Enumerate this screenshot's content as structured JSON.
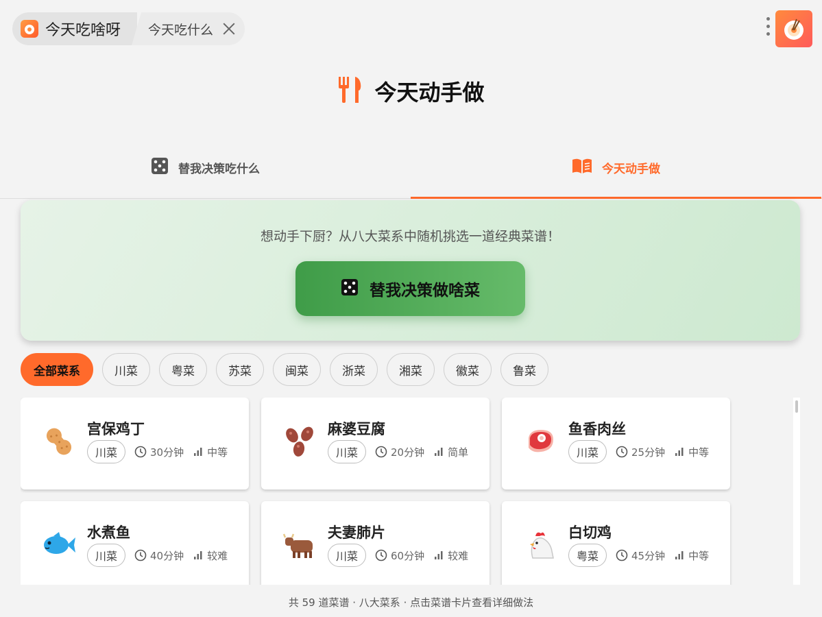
{
  "window": {
    "app_title": "今天吃啥呀",
    "tab_title": "今天吃什么"
  },
  "header": {
    "title": "今天动手做"
  },
  "nav": {
    "tabs": [
      {
        "label": "替我决策吃什么",
        "icon": "dice-icon"
      },
      {
        "label": "今天动手做",
        "icon": "book-icon"
      }
    ]
  },
  "hero": {
    "subtitle": "想动手下厨？从八大菜系中随机挑选一道经典菜谱！",
    "cta_label": "替我决策做啥菜"
  },
  "filters": [
    "全部菜系",
    "川菜",
    "粤菜",
    "苏菜",
    "闽菜",
    "浙菜",
    "湘菜",
    "徽菜",
    "鲁菜"
  ],
  "recipes": [
    {
      "name": "宫保鸡丁",
      "cuisine": "川菜",
      "time": "30分钟",
      "difficulty": "中等",
      "icon": "peanut-icon"
    },
    {
      "name": "麻婆豆腐",
      "cuisine": "川菜",
      "time": "20分钟",
      "difficulty": "简单",
      "icon": "beans-icon"
    },
    {
      "name": "鱼香肉丝",
      "cuisine": "川菜",
      "time": "25分钟",
      "difficulty": "中等",
      "icon": "meat-icon"
    },
    {
      "name": "水煮鱼",
      "cuisine": "川菜",
      "time": "40分钟",
      "difficulty": "较难",
      "icon": "fish-icon"
    },
    {
      "name": "夫妻肺片",
      "cuisine": "川菜",
      "time": "60分钟",
      "difficulty": "较难",
      "icon": "ox-icon"
    },
    {
      "name": "白切鸡",
      "cuisine": "粤菜",
      "time": "45分钟",
      "difficulty": "中等",
      "icon": "chicken-icon"
    }
  ],
  "footer": {
    "text": "共 59 道菜谱 · 八大菜系 · 点击菜谱卡片查看详细做法"
  },
  "colors": {
    "accent": "#ff6a2b",
    "cta": "#4caf50"
  }
}
